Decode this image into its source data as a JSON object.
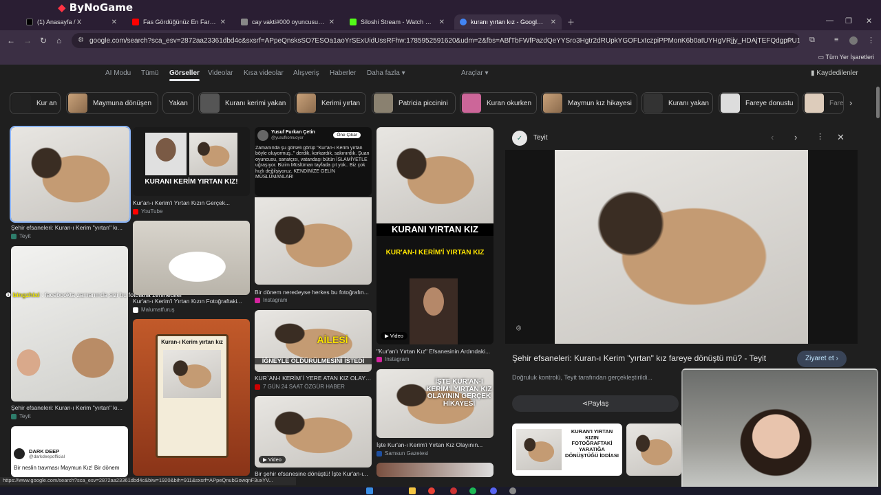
{
  "brand": {
    "logo_prefix": "By",
    "logo_suffix": "NoGame"
  },
  "tabs": [
    {
      "title": "(1) Anasayfa / X",
      "color": "#000000"
    },
    {
      "title": "Fas Gördüğünüz En Farklı Ülke",
      "color": "#ff0000"
    },
    {
      "title": "cay vakti#000 oyuncusunun Ca",
      "color": "#888888"
    },
    {
      "title": "Siloshi Stream - Watch Live on",
      "color": "#53fc18"
    },
    {
      "title": "kuranı yırtan kız - Google'da A",
      "color": "#4285f4"
    }
  ],
  "toolbar": {
    "url": "google.com/search?sca_esv=2872aa23361dbd4c&sxsrf=APpeQnsksSO7ESOa1aoYrSExUidUssRFhw:1785952591620&udm=2&fbs=ABfTbFWfPazdQeYYSro3Hgtr2dRUpkYGOFLxtczpiPPMonK6b0atUYHgVRjjy_HDAjTEFQdgpPU119lvAq9bPIGk9X5..."
  },
  "bookmarks": {
    "all": "Tüm Yer İşaretleri"
  },
  "gtabs": [
    "AI Modu",
    "Tümü",
    "Görseller",
    "Videolar",
    "Kısa videolar",
    "Alışveriş",
    "Haberler",
    "Daha fazla",
    "Araçlar"
  ],
  "saved": "Kaydedilenler",
  "chips": [
    "Kur an",
    "Maymuna dönüşen",
    "Yakan",
    "Kuranı kerimi yakan",
    "Kerimi yırtan",
    "Patricia piccinini",
    "Kuran okurken",
    "Maymun kız hikayesi",
    "Kuranı yakan",
    "Fareye donustu",
    "Fare"
  ],
  "grid": {
    "r1c1": {
      "caption": "Şehir efsaneleri: Kuran-ı Kerim \"yırtan\" kı...",
      "source": "Teyit"
    },
    "r1c2": {
      "caption": "Kur'an-ı Kerim'i Yırtan Kızın Gerçek...",
      "source": "YouTube",
      "overlay": "KURANI KERİM YIRTAN KIZ!"
    },
    "r1c3": {
      "author": "Yusuf Furkan Çetin",
      "handle": "@yusufkomuoyor",
      "badge": "Öne Çıkar",
      "text": "Zamanında şu görseli görüp \"Kur'an-ı Kerim yırtan böyle oluyormuş..\" derdik, korkardık, sakınırdık. Şuan oyuncusu, sanatçısı, vatandaşı bütün İSLAMİYETLE uğraşıyor. Bizim Müslüman tayfada çıt yok.. Biz çok hızlı değilşiyoruz. KENDİNİZE GELİN MÜSLÜMANLAR!",
      "caption": "Bir dönem neredeyse herkes bu fotoğrafın...",
      "source": "Instagram"
    },
    "r1c4": {
      "overlay1": "KURANI YIRTAN KIZ",
      "overlay2": "KUR'AN-I KERİM'İ YIRTAN KIZ",
      "video": "Video",
      "caption": "\"Kur'an'ı Yırtan Kız\" Efsanesinin Ardındaki...",
      "source": "Instagram"
    },
    "r2c1": {
      "caption": "Şehir efsaneleri: Kuran-ı Kerim \"yırtan\" kı...",
      "source": "Teyit"
    },
    "r2c2": {
      "caption": "Kur'an-ı Kerim'i Yırtan Kızın Fotoğraftaki...",
      "source": "Malumatfuruş"
    },
    "r2c3": {
      "overlay1": "AİLESİ",
      "overlay2": "İĞNEYLE ÖLDÜRÜLMESİNİ İSTEDİ",
      "caption": "KUR`AN-I KERİM`İ YERE ATAN KIZ OLAYININ...",
      "source": "7 GÜN 24 SAAT ÖZGÜR HABER"
    },
    "r2c4": {
      "overlay": "İŞTE KUR'AN-I KERİM'İ YIRTAN KIZ OLAYININ GERÇEK HİKAYESİ",
      "caption": "İşte Kur'an-ı Kerim'i Yırtan Kız Olayının...",
      "source": "Samsun Gazetesi"
    },
    "r3c1": {
      "author": "DARK DEEP",
      "handle": "@darkdeepofficial",
      "text": "Bir neslin travması Maymun Kız! Bir dönem"
    },
    "r3c2": {
      "title": "Kuran-ı Kerim yırtan kız"
    },
    "r3c3": {
      "video": "Video",
      "caption": "Bir şehir efsanesine dönüştü! İşte Kur'an-ı..."
    }
  },
  "chat": {
    "user": "bingzhixi",
    "message": "facebookta zamanında sizi bu fotolarla zehirlediler"
  },
  "panel": {
    "site": "Teyit",
    "title": "Şehir efsaneleri: Kuran-ı Kerim \"yırtan\" kız fareye dönüştü mü? - Teyit",
    "visit": "Ziyaret et",
    "desc": "Doğruluk kontrolü, Teyit tarafından gerçekleştirildi...",
    "share": "Paylaş",
    "related_overlay": "KURAN'I YIRTAN KIZIN FOTOĞRAFTAKİ YARATIĞA DÖNÜŞTÜĞÜ İDDİASI"
  },
  "statusbar": "https://www.google.com/search?sca_esv=2872aa23361dbd4c&biw=1920&bih=911&sxsrf=APpeQnubGowqnF3uxYV..."
}
